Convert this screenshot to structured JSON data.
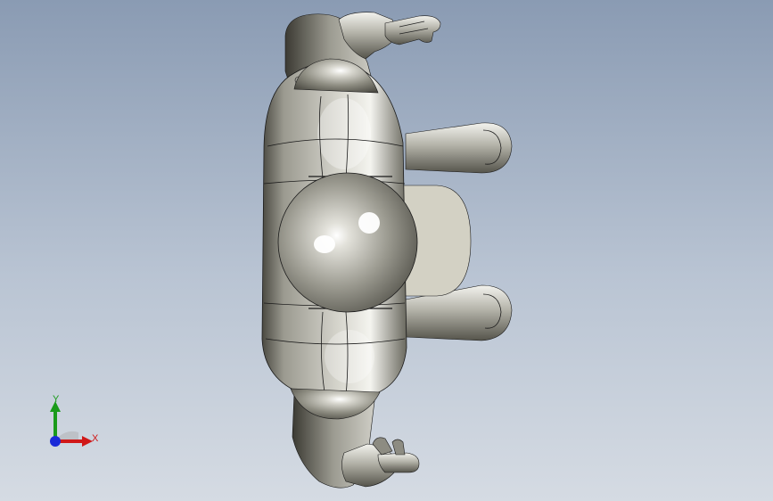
{
  "viewport": {
    "background_top": "#8a9bb3",
    "background_bottom": "#d5dbe3"
  },
  "model": {
    "name": "robot-figure-top-view",
    "material_color": "#9c9b8f",
    "highlight_color": "#ffffff",
    "edge_color": "#1a1a1a"
  },
  "triad": {
    "x_label": "X",
    "y_label": "Y",
    "x_color": "#d01818",
    "y_color": "#1a9a1a",
    "z_color": "#1a2ad8"
  }
}
